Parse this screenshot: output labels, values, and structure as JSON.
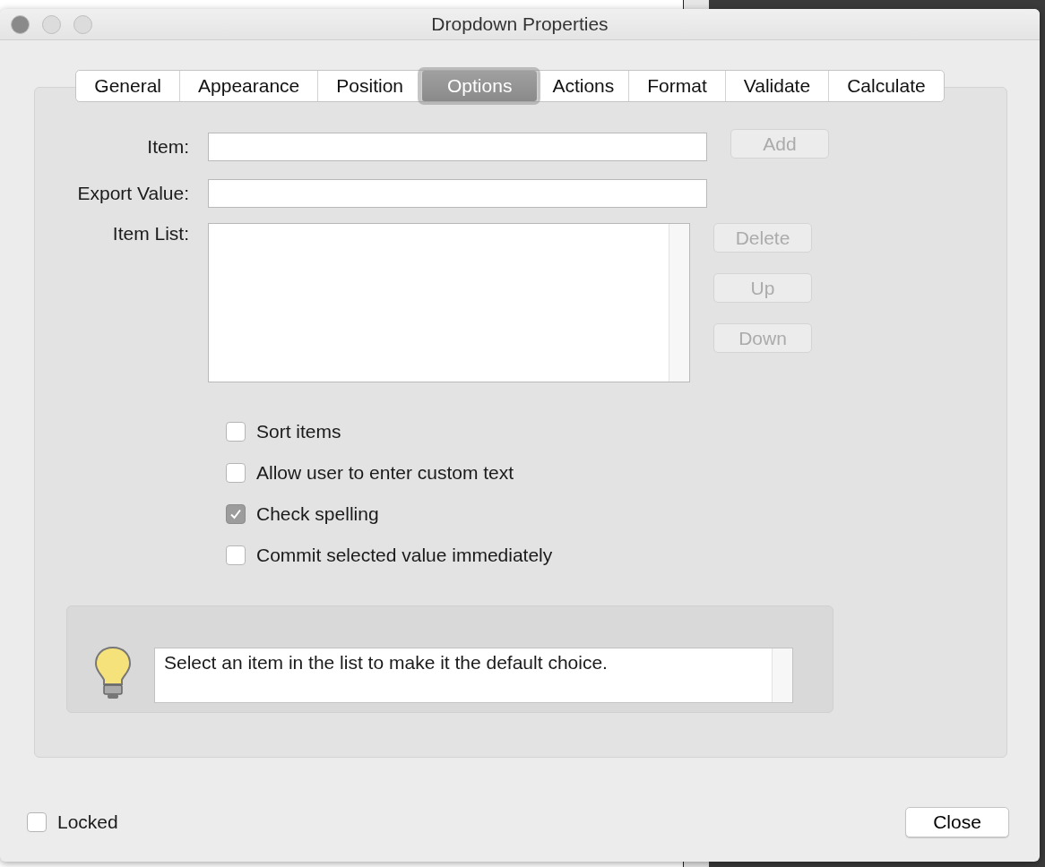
{
  "window": {
    "title": "Dropdown Properties"
  },
  "tabs": [
    {
      "label": "General",
      "selected": false
    },
    {
      "label": "Appearance",
      "selected": false
    },
    {
      "label": "Position",
      "selected": false
    },
    {
      "label": "Options",
      "selected": true
    },
    {
      "label": "Actions",
      "selected": false
    },
    {
      "label": "Format",
      "selected": false
    },
    {
      "label": "Validate",
      "selected": false
    },
    {
      "label": "Calculate",
      "selected": false
    }
  ],
  "item": {
    "label": "Item:",
    "button": {
      "label": "Add",
      "disabled": true
    }
  },
  "export_value": {
    "label": "Export Value:"
  },
  "item_list": {
    "label": "Item List:",
    "buttons": [
      {
        "label": "Delete",
        "disabled": true
      },
      {
        "label": "Up",
        "disabled": true
      },
      {
        "label": "Down",
        "disabled": true
      }
    ]
  },
  "options": [
    {
      "label": "Sort items",
      "checked": false
    },
    {
      "label": "Allow user to enter custom text",
      "checked": false
    },
    {
      "label": "Check spelling",
      "checked": true
    },
    {
      "label": "Commit selected value immediately",
      "checked": false
    }
  ],
  "hint": {
    "text": "Select an item in the list to make it the default choice."
  },
  "locked": {
    "label": "Locked",
    "checked": false
  },
  "close_button": {
    "label": "Close"
  }
}
